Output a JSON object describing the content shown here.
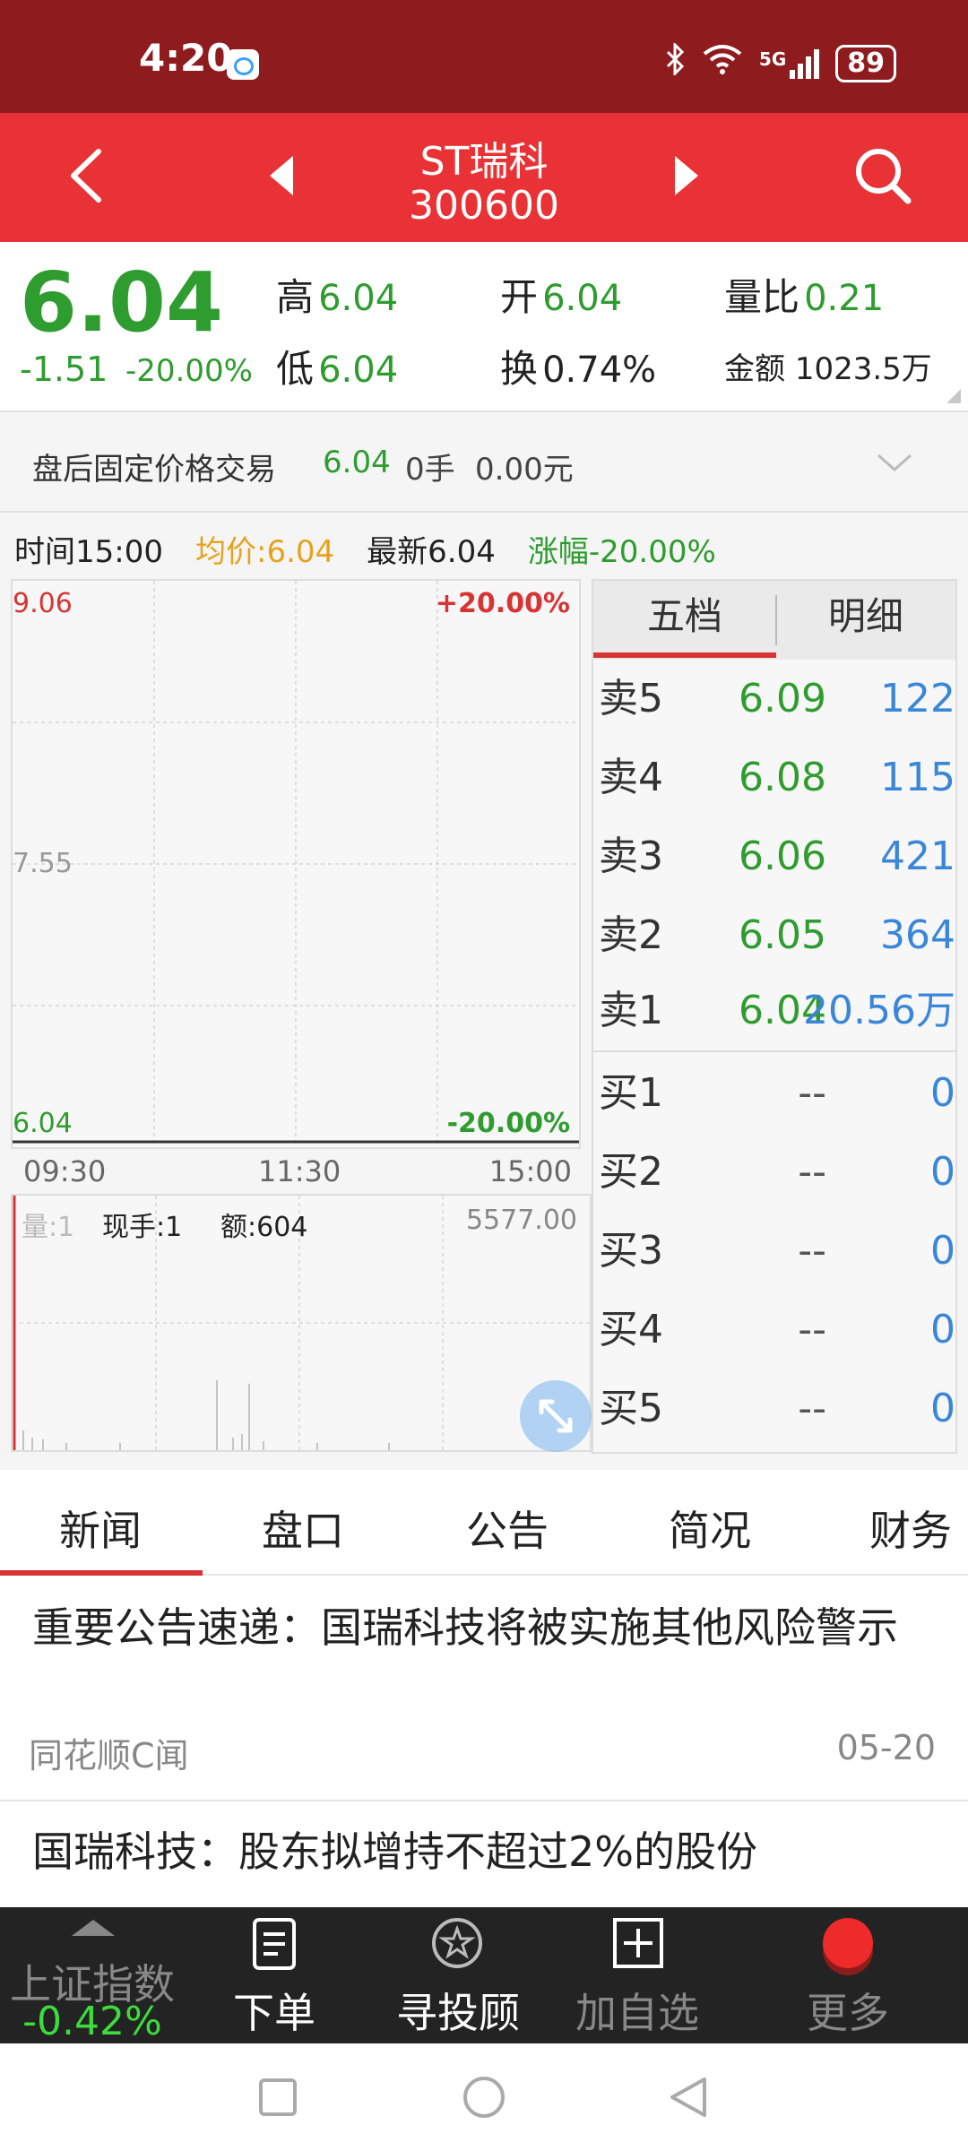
{
  "status_bar": {
    "time": "4:20",
    "battery": "89",
    "network": "5G"
  },
  "header": {
    "name": "ST瑞科",
    "code": "300600"
  },
  "quote": {
    "last_price": "6.04",
    "change": "-1.51",
    "change_pct": "-20.00%",
    "high_label": "高",
    "high": "6.04",
    "open_label": "开",
    "open": "6.04",
    "vol_ratio_label": "量比",
    "vol_ratio": "0.21",
    "low_label": "低",
    "low": "6.04",
    "turnover_label": "换",
    "turnover": "0.74%",
    "amount_label": "金额",
    "amount": "1023.5万"
  },
  "after_hours": {
    "label": "盘后固定价格交易",
    "price": "6.04",
    "volume": "0手",
    "amount": "0.00元"
  },
  "chart_info": {
    "time": "时间15:00",
    "avg": "均价:6.04",
    "latest": "最新6.04",
    "change": "涨幅-20.00%"
  },
  "price_chart": {
    "top_price": "9.06",
    "top_pct": "+20.00%",
    "mid_price": "7.55",
    "bottom_price": "6.04",
    "bottom_pct": "-20.00%",
    "times": [
      "09:30",
      "11:30",
      "15:00"
    ]
  },
  "volume_chart": {
    "label_vol": "量:1",
    "label_hand": "现手:1",
    "label_amt": "额:604",
    "max": "5577.00"
  },
  "order_book": {
    "tab_five": "五档",
    "tab_detail": "明细",
    "asks": [
      {
        "label": "卖5",
        "price": "6.09",
        "vol": "122"
      },
      {
        "label": "卖4",
        "price": "6.08",
        "vol": "115"
      },
      {
        "label": "卖3",
        "price": "6.06",
        "vol": "421"
      },
      {
        "label": "卖2",
        "price": "6.05",
        "vol": "364"
      },
      {
        "label": "卖1",
        "price": "6.04",
        "vol": "20.56万"
      }
    ],
    "bids": [
      {
        "label": "买1",
        "price": "--",
        "vol": "0"
      },
      {
        "label": "买2",
        "price": "--",
        "vol": "0"
      },
      {
        "label": "买3",
        "price": "--",
        "vol": "0"
      },
      {
        "label": "买4",
        "price": "--",
        "vol": "0"
      },
      {
        "label": "买5",
        "price": "--",
        "vol": "0"
      }
    ]
  },
  "news_tabs": [
    "新闻",
    "盘口",
    "公告",
    "简况",
    "财务"
  ],
  "news": [
    {
      "title": "重要公告速递：国瑞科技将被实施其他风险警示",
      "source": "同花顺C闻",
      "date": "05-20"
    },
    {
      "title": "国瑞科技：股东拟增持不超过2%的股份"
    }
  ],
  "bottom_nav": {
    "index_label": "上证指数",
    "index_value": "-0.42%",
    "order": "下单",
    "advisor": "寻投顾",
    "watchlist": "加自选",
    "more": "更多"
  }
}
